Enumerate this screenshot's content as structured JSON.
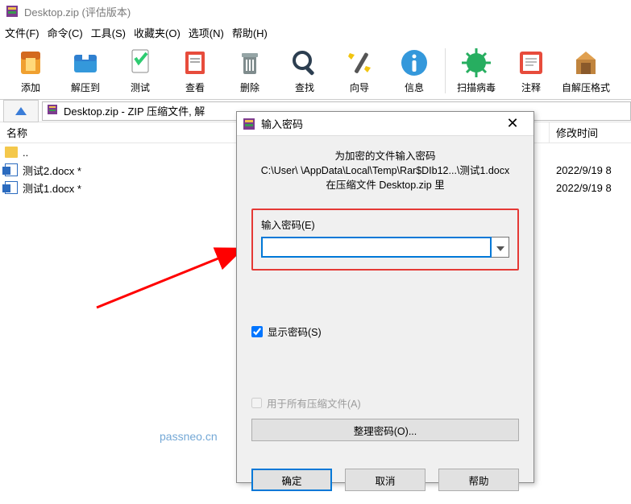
{
  "titlebar": {
    "title": "Desktop.zip (评估版本)"
  },
  "menus": [
    "文件(F)",
    "命令(C)",
    "工具(S)",
    "收藏夹(O)",
    "选项(N)",
    "帮助(H)"
  ],
  "toolbar": [
    {
      "key": "add",
      "label": "添加"
    },
    {
      "key": "extract",
      "label": "解压到"
    },
    {
      "key": "test",
      "label": "测试"
    },
    {
      "key": "view",
      "label": "查看"
    },
    {
      "key": "delete",
      "label": "删除"
    },
    {
      "key": "find",
      "label": "查找"
    },
    {
      "key": "wizard",
      "label": "向导"
    },
    {
      "key": "info",
      "label": "信息"
    },
    {
      "key": "virus",
      "label": "扫描病毒"
    },
    {
      "key": "comment",
      "label": "注释"
    },
    {
      "key": "sfx",
      "label": "自解压格式"
    }
  ],
  "address": "Desktop.zip - ZIP 压缩文件, 解",
  "columns": {
    "name": "名称",
    "date": "修改时间"
  },
  "files": [
    {
      "name": "..",
      "type": "up",
      "date": ""
    },
    {
      "name": "测试2.docx *",
      "type": "docx",
      "date": "2022/9/19 8"
    },
    {
      "name": "测试1.docx *",
      "type": "docx",
      "date": "2022/9/19 8"
    }
  ],
  "watermark": "passneo.cn",
  "dialog": {
    "title": "输入密码",
    "line1": "为加密的文件输入密码",
    "line2": "C:\\User\\            \\AppData\\Local\\Temp\\Rar$DIb12...\\测试1.docx",
    "line3": "在压缩文件 Desktop.zip 里",
    "pwd_label": "输入密码(E)",
    "pwd_value": "",
    "show_pwd": "显示密码(S)",
    "show_pwd_checked": true,
    "use_all": "用于所有压缩文件(A)",
    "use_all_checked": false,
    "organize": "整理密码(O)...",
    "ok": "确定",
    "cancel": "取消",
    "help": "帮助"
  }
}
